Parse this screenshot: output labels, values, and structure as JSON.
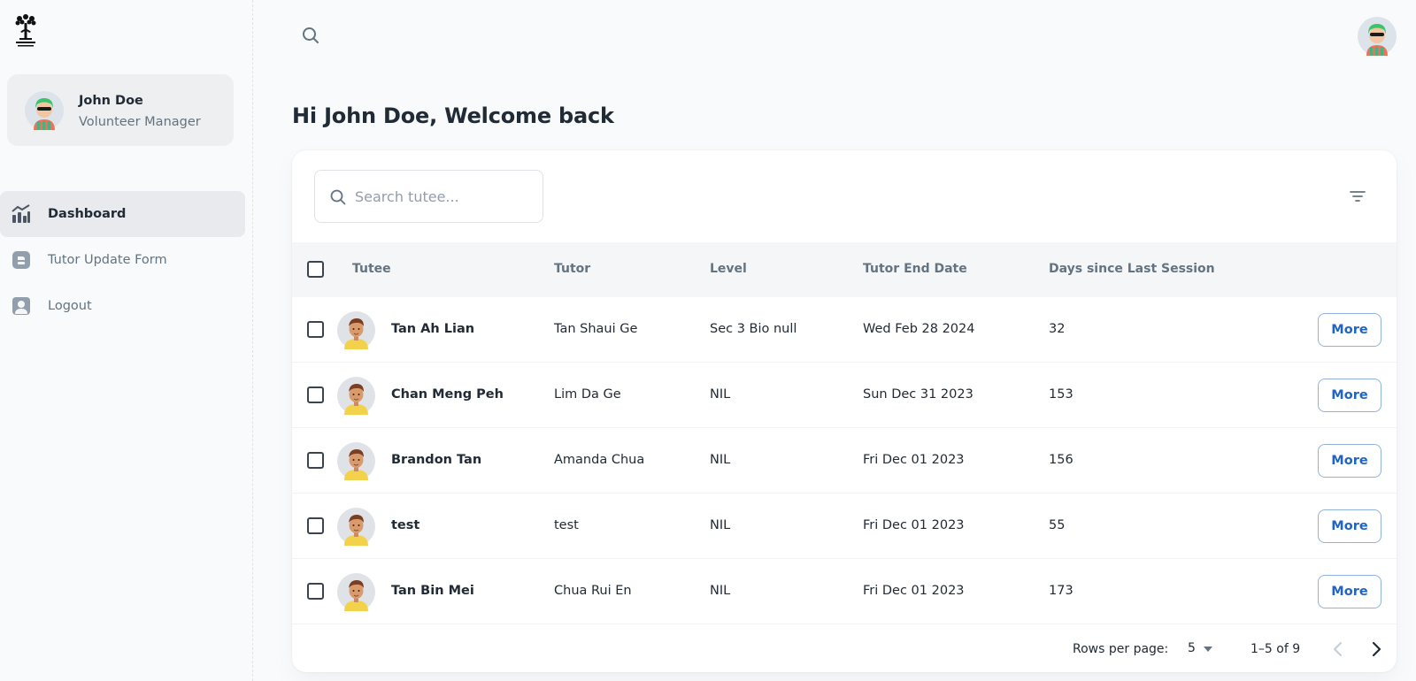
{
  "sidebar": {
    "logo_icon": "tree-logo-icon",
    "account": {
      "name": "John Doe",
      "role": "Volunteer Manager"
    },
    "nav": [
      {
        "label": "Dashboard",
        "icon": "chart-icon",
        "active": true
      },
      {
        "label": "Tutor Update Form",
        "icon": "form-icon",
        "active": false
      },
      {
        "label": "Logout",
        "icon": "user-icon",
        "active": false
      }
    ]
  },
  "header": {
    "search_icon": "search-icon",
    "avatar_icon": "avatar"
  },
  "main": {
    "greeting": "Hi John Doe, Welcome back",
    "search": {
      "placeholder": "Search tutee..."
    },
    "columns": [
      "Tutee",
      "Tutor",
      "Level",
      "Tutor End Date",
      "Days since Last Session"
    ],
    "rows": [
      {
        "tutee": "Tan Ah Lian",
        "tutor": "Tan Shaui Ge",
        "level": "Sec 3 Bio null",
        "end_date": "Wed Feb 28 2024",
        "days": "32",
        "action": "More"
      },
      {
        "tutee": "Chan Meng Peh",
        "tutor": "Lim Da Ge",
        "level": "NIL",
        "end_date": "Sun Dec 31 2023",
        "days": "153",
        "action": "More"
      },
      {
        "tutee": "Brandon Tan",
        "tutor": "Amanda Chua",
        "level": "NIL",
        "end_date": "Fri Dec 01 2023",
        "days": "156",
        "action": "More"
      },
      {
        "tutee": "test",
        "tutor": "test",
        "level": "NIL",
        "end_date": "Fri Dec 01 2023",
        "days": "55",
        "action": "More"
      },
      {
        "tutee": "Tan Bin Mei",
        "tutor": "Chua Rui En",
        "level": "NIL",
        "end_date": "Fri Dec 01 2023",
        "days": "173",
        "action": "More"
      }
    ],
    "pagination": {
      "rows_per_page_label": "Rows per page:",
      "rows_per_page": "5",
      "range": "1–5 of 9"
    }
  },
  "colors": {
    "accent": "#2065c3",
    "text": "#212b36",
    "muted": "#637381",
    "background": "#f9fafb"
  }
}
